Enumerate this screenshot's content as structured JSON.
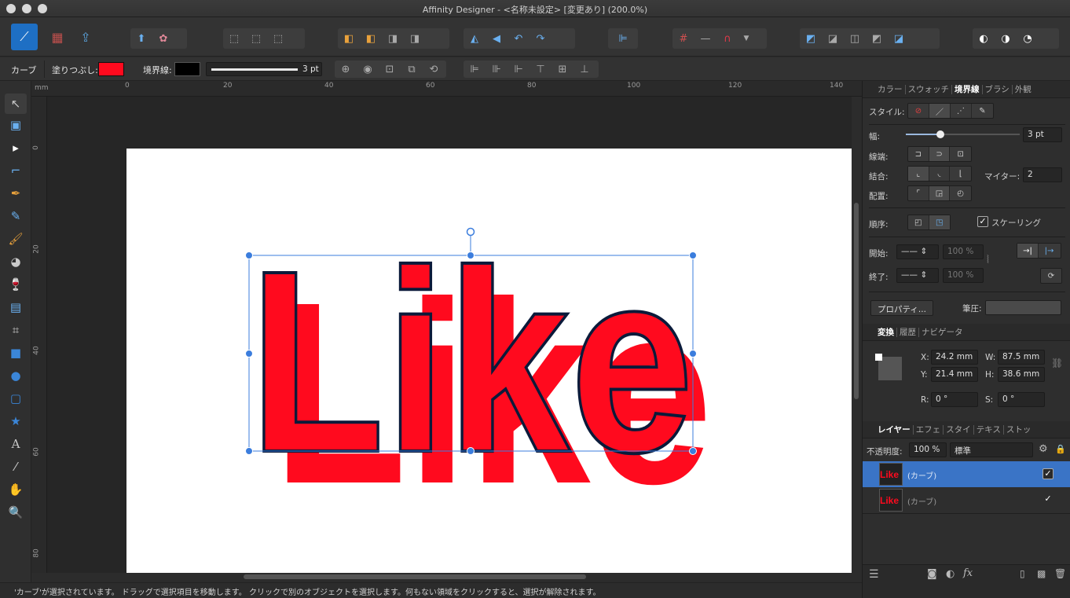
{
  "window": {
    "title": "Affinity Designer - <名称未設定> [変更あり] (200.0%)"
  },
  "context_bar": {
    "object_type": "カーブ",
    "fill_label": "塗りつぶし:",
    "fill_color": "#ff0a1e",
    "stroke_label": "境界線:",
    "stroke_color": "#000000",
    "stroke_width": "3 pt"
  },
  "ruler": {
    "unit": "mm",
    "h_ticks": [
      "0",
      "20",
      "40",
      "60",
      "80",
      "100",
      "120",
      "140"
    ],
    "v_ticks": [
      "0",
      "20",
      "40",
      "60",
      "80"
    ]
  },
  "canvas": {
    "artwork_text": "Like",
    "artwork_color": "#ff0a1e",
    "selection_color": "#3b7ddd"
  },
  "stroke_panel": {
    "tabs": [
      "カラー",
      "スウォッチ",
      "境界線",
      "ブラシ",
      "外観"
    ],
    "active_tab": "境界線",
    "style_label": "スタイル:",
    "width_label": "幅:",
    "width_value": "3 pt",
    "width_slider_fraction": 0.3,
    "cap_label": "線端:",
    "join_label": "結合:",
    "miter_label": "マイター:",
    "miter_value": "2",
    "align_label": "配置:",
    "order_label": "順序:",
    "scaling_label": "スケーリング",
    "scaling_checked": true,
    "start_label": "開始:",
    "end_label": "終了:",
    "start_percent": "100 %",
    "end_percent": "100 %",
    "properties_button": "プロパティ...",
    "pressure_label": "筆圧:"
  },
  "transform_panel": {
    "tabs": [
      "変換",
      "履歴",
      "ナビゲータ"
    ],
    "active_tab": "変換",
    "x_label": "X:",
    "x_value": "24.2 mm",
    "y_label": "Y:",
    "y_value": "21.4 mm",
    "w_label": "W:",
    "w_value": "87.5 mm",
    "h_label": "H:",
    "h_value": "38.6 mm",
    "r_label": "R:",
    "r_value": "0 °",
    "s_label": "S:",
    "s_value": "0 °"
  },
  "layers_panel": {
    "tabs": [
      "レイヤー",
      "エフェ",
      "スタイ",
      "テキス",
      "ストッ"
    ],
    "active_tab": "レイヤー",
    "opacity_label": "不透明度:",
    "opacity_value": "100 %",
    "blend_mode": "標準",
    "layers": [
      {
        "thumb_text": "Like",
        "name": "(カーブ)",
        "selected": true,
        "visible": true
      },
      {
        "thumb_text": "Like",
        "name": "(カーブ)",
        "selected": false,
        "visible": true
      }
    ]
  },
  "status": {
    "message": "'カーブ'が選択されています。 ドラッグで選択項目を移動します。 クリックで別のオブジェクトを選択します。何もない領域をクリックすると、選択が解除されます。"
  }
}
